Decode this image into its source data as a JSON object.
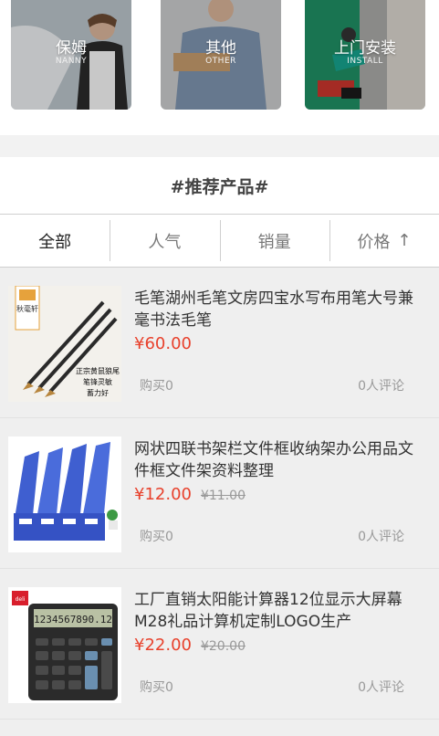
{
  "services": [
    {
      "title": "保姆",
      "subtitle": "NANNY"
    },
    {
      "title": "其他",
      "subtitle": "OTHER"
    },
    {
      "title": "上门安装",
      "subtitle": "INSTALL"
    }
  ],
  "recommend": {
    "title": "#推荐产品#"
  },
  "tabs": [
    {
      "label": "全部"
    },
    {
      "label": "人气"
    },
    {
      "label": "销量"
    },
    {
      "label": "价格",
      "icon": "arrow-up-icon",
      "arrow": "↑"
    }
  ],
  "products": [
    {
      "name": "毛笔湖州毛笔文房四宝水写布用笔大号兼毫书法毛笔",
      "price": "¥60.00",
      "old_price": "",
      "bought": "购买0",
      "reviews": "0人评论",
      "image": "calligraphy-brush-image",
      "image_texts": {
        "brand": "秋毫轩",
        "caption": [
          "正宗黄鼠狼尾",
          "笔锋灵敏",
          "蓄力好"
        ]
      }
    },
    {
      "name": "网状四联书架栏文件框收纳架办公用品文件框文件架资料整理",
      "price": "¥12.00",
      "old_price": "¥11.00",
      "bought": "购买0",
      "reviews": "0人评论",
      "image": "file-rack-image",
      "image_texts": {}
    },
    {
      "name": "工厂直销太阳能计算器12位显示大屏幕M28礼品计算机定制LOGO生产",
      "price": "¥22.00",
      "old_price": "¥20.00",
      "bought": "购买0",
      "reviews": "0人评论",
      "image": "calculator-image",
      "image_texts": {
        "brand": "deli",
        "display": "1234567890.12"
      }
    }
  ],
  "colors": {
    "accent_price": "#e8412c",
    "text": "#333333",
    "muted": "#999999"
  }
}
